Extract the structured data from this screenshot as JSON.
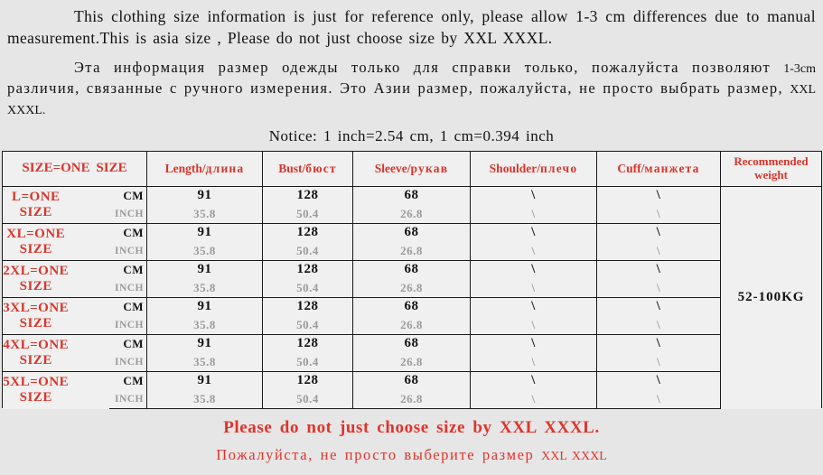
{
  "intro": {
    "english": "This clothing size information is just for reference only, please allow 1-3 cm differences due to manual measurement.This is asia size , Please do not just choose size by XXL XXXL.",
    "russian_part1": "Эта информация размер одежды только для справки только, пожалуйста позволяют ",
    "russian_measure": "1-3cm",
    "russian_part2": " различия, связанные с ручного измерения. Это Азии размер, пожалуйста, не просто выбрать размер, ",
    "russian_sizes": "XXL XXXL."
  },
  "notice": "Notice: 1 inch=2.54 cm, 1 cm=0.394 inch",
  "table": {
    "headers": {
      "size": "SIZE=ONE SIZE",
      "length_en": "Length/",
      "length_ru": "длина",
      "bust_en": "Bust/",
      "bust_ru": "бюст",
      "sleeve_en": "Sleeve/",
      "sleeve_ru": "рукав",
      "shoulder_en": "Shoulder/",
      "shoulder_ru": "плечо",
      "cuff_en": "Cuff/",
      "cuff_ru": "манжета",
      "weight": "Recommended weight"
    },
    "units": {
      "cm": "CM",
      "inch": "INCH"
    },
    "weight_value": "52-100KG",
    "rows": [
      {
        "size": "L=ONE SIZE",
        "cm": {
          "length": "91",
          "bust": "128",
          "sleeve": "68",
          "shoulder": "\\",
          "cuff": "\\"
        },
        "inch": {
          "length": "35.8",
          "bust": "50.4",
          "sleeve": "26.8",
          "shoulder": "\\",
          "cuff": "\\"
        }
      },
      {
        "size": "XL=ONE SIZE",
        "cm": {
          "length": "91",
          "bust": "128",
          "sleeve": "68",
          "shoulder": "\\",
          "cuff": "\\"
        },
        "inch": {
          "length": "35.8",
          "bust": "50.4",
          "sleeve": "26.8",
          "shoulder": "\\",
          "cuff": "\\"
        }
      },
      {
        "size": "2XL=ONE SIZE",
        "cm": {
          "length": "91",
          "bust": "128",
          "sleeve": "68",
          "shoulder": "\\",
          "cuff": "\\"
        },
        "inch": {
          "length": "35.8",
          "bust": "50.4",
          "sleeve": "26.8",
          "shoulder": "\\",
          "cuff": "\\"
        }
      },
      {
        "size": "3XL=ONE SIZE",
        "cm": {
          "length": "91",
          "bust": "128",
          "sleeve": "68",
          "shoulder": "\\",
          "cuff": "\\"
        },
        "inch": {
          "length": "35.8",
          "bust": "50.4",
          "sleeve": "26.8",
          "shoulder": "\\",
          "cuff": "\\"
        }
      },
      {
        "size": "4XL=ONE SIZE",
        "cm": {
          "length": "91",
          "bust": "128",
          "sleeve": "68",
          "shoulder": "\\",
          "cuff": "\\"
        },
        "inch": {
          "length": "35.8",
          "bust": "50.4",
          "sleeve": "26.8",
          "shoulder": "\\",
          "cuff": "\\"
        }
      },
      {
        "size": "5XL=ONE SIZE",
        "cm": {
          "length": "91",
          "bust": "128",
          "sleeve": "68",
          "shoulder": "\\",
          "cuff": "\\"
        },
        "inch": {
          "length": "35.8",
          "bust": "50.4",
          "sleeve": "26.8",
          "shoulder": "\\",
          "cuff": "\\"
        }
      }
    ]
  },
  "footer": {
    "line_en": "Please do not just choose size by XXL XXXL.",
    "line_ru_main": "Пожалуйста, не просто выберите размер ",
    "line_ru_sizes": "XXL XXXL"
  },
  "colors": {
    "accent_red": "#d8352a",
    "footer_red": "#e0332a",
    "text_black": "#111111",
    "inch_gray": "#9a9a9a",
    "page_bg": "#e6e6e6",
    "cell_bg": "#f0f0f0",
    "border": "#1a1a1a"
  }
}
